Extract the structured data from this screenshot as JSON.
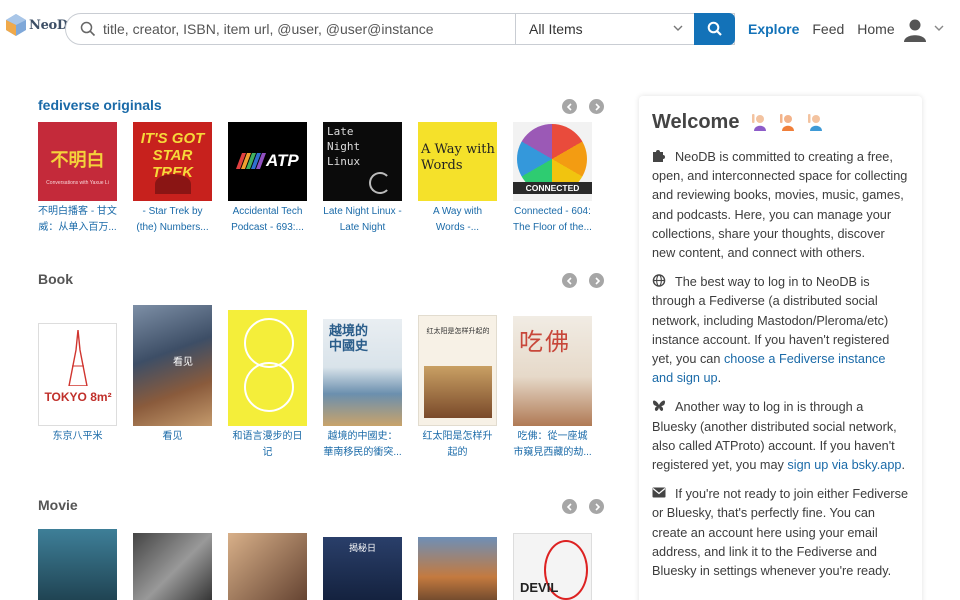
{
  "header": {
    "logo_text": "NeoDB",
    "search_placeholder": "title, creator, ISBN, item url, @user, @user@instance",
    "category_selected": "All Items",
    "nav": {
      "explore": "Explore",
      "feed": "Feed",
      "home": "Home"
    },
    "accent_color": "#1372b8"
  },
  "sections": {
    "fediverse": {
      "title": "fediverse originals",
      "items": [
        {
          "caption": "不明白播客 - 甘文威：从单入百万...",
          "cover_text": "不明白",
          "cover_sub": "Conversations with Yaxue Li"
        },
        {
          "caption": "- Star Trek by (the) Numbers...",
          "cover_text": "IT'S GOT STAR TREK",
          "cover_sub": ""
        },
        {
          "caption": "Accidental Tech Podcast - 693:...",
          "cover_text": "ATP",
          "cover_sub": ""
        },
        {
          "caption": "Late Night Linux - Late Night Linux...",
          "cover_text": "Late Night Linux",
          "cover_sub": ""
        },
        {
          "caption": "A Way with Words -...",
          "cover_text": "A Way with Words",
          "cover_sub": ""
        },
        {
          "caption": "Connected - 604: The Floor of the...",
          "cover_text": "CONNECTED",
          "cover_sub": ""
        }
      ]
    },
    "book": {
      "title": "Book",
      "items": [
        {
          "caption": "东京八平米",
          "cover_text": "TOKYO 8m²"
        },
        {
          "caption": "看见",
          "cover_text": "看见"
        },
        {
          "caption": "和语言漫步的日记",
          "cover_text": ""
        },
        {
          "caption": "越境的中國史：華南移民的衝突...",
          "cover_text": "越境的中國史"
        },
        {
          "caption": "红太阳是怎样升起的",
          "cover_text": "红太阳是怎样升起的"
        },
        {
          "caption": "吃佛：從一座城市窺見西藏的劫...",
          "cover_text": "吃佛"
        }
      ]
    },
    "movie": {
      "title": "Movie",
      "items": [
        {
          "caption": "",
          "cover_text": ""
        },
        {
          "caption": "",
          "cover_text": ""
        },
        {
          "caption": "",
          "cover_text": ""
        },
        {
          "caption": "",
          "cover_text": "揭秘日"
        },
        {
          "caption": "",
          "cover_text": ""
        },
        {
          "caption": "",
          "cover_text": "DEVIL"
        }
      ]
    }
  },
  "sidebar": {
    "title": "Welcome",
    "p1": "NeoDB is committed to creating a free, open, and interconnected space for collecting and reviewing books, movies, music, games, and podcasts. Here, you can manage your collections, share your thoughts, discover new content, and connect with others.",
    "p2_a": "The best way to log in to NeoDB is through a Fediverse (a distributed social network, including Mastodon/Pleroma/etc) instance account. If you haven't registered yet, you can ",
    "p2_link": "choose a Fediverse instance and sign up",
    "p2_b": ".",
    "p3_a": "Another way to log in is through a Bluesky (another distributed social network, also called ATProto) account. If you haven't registered yet, you may ",
    "p3_link": "sign up via bsky.app",
    "p3_b": ".",
    "p4": "If you're not ready to join either Fediverse or Bluesky, that's perfectly fine. You can create an account here using your email address, and link it to the Fediverse and Bluesky in settings whenever you're ready."
  }
}
